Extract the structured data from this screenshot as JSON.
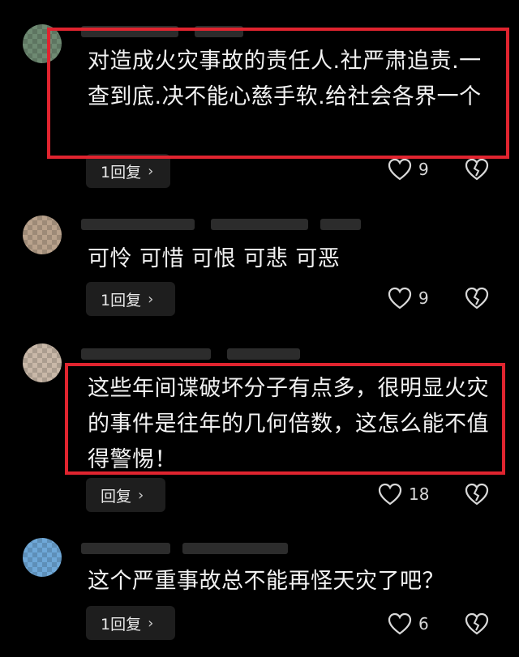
{
  "comments": [
    {
      "text": "对造成火灾事故的责任人.社严肃追责.一查到底.决不能心慈手软.给社会各界一个",
      "reply_label": "1回复",
      "likes": "9",
      "avatar_colors": [
        "#6e8a72",
        "#c7a06a",
        "#3d5a80"
      ]
    },
    {
      "text": "可怜 可惜 可恨 可悲 可恶",
      "reply_label": "1回复",
      "likes": "9",
      "avatar_colors": [
        "#b9a28c",
        "#8f7a66",
        "#d4c3ad"
      ]
    },
    {
      "text": "这些年间谍破坏分子有点多，很明显火灾的事件是往年的几何倍数，这怎么能不值得警惕！",
      "reply_label": "回复",
      "likes": "18",
      "avatar_colors": [
        "#c9b8a8",
        "#e8ddd0",
        "#7a6a5c"
      ]
    },
    {
      "text": "这个严重事故总不能再怪天灾了吧？",
      "reply_label": "1回复",
      "likes": "6",
      "avatar_colors": [
        "#6fa8d8",
        "#2e6fa8",
        "#d0e4f2"
      ]
    }
  ],
  "icons": {
    "chevron": "›",
    "like": "heart-outline-icon",
    "dislike": "broken-heart-icon"
  },
  "colors": {
    "background": "#000000",
    "highlight_border": "#e0242f",
    "reply_button_bg": "#1e1e1e"
  }
}
